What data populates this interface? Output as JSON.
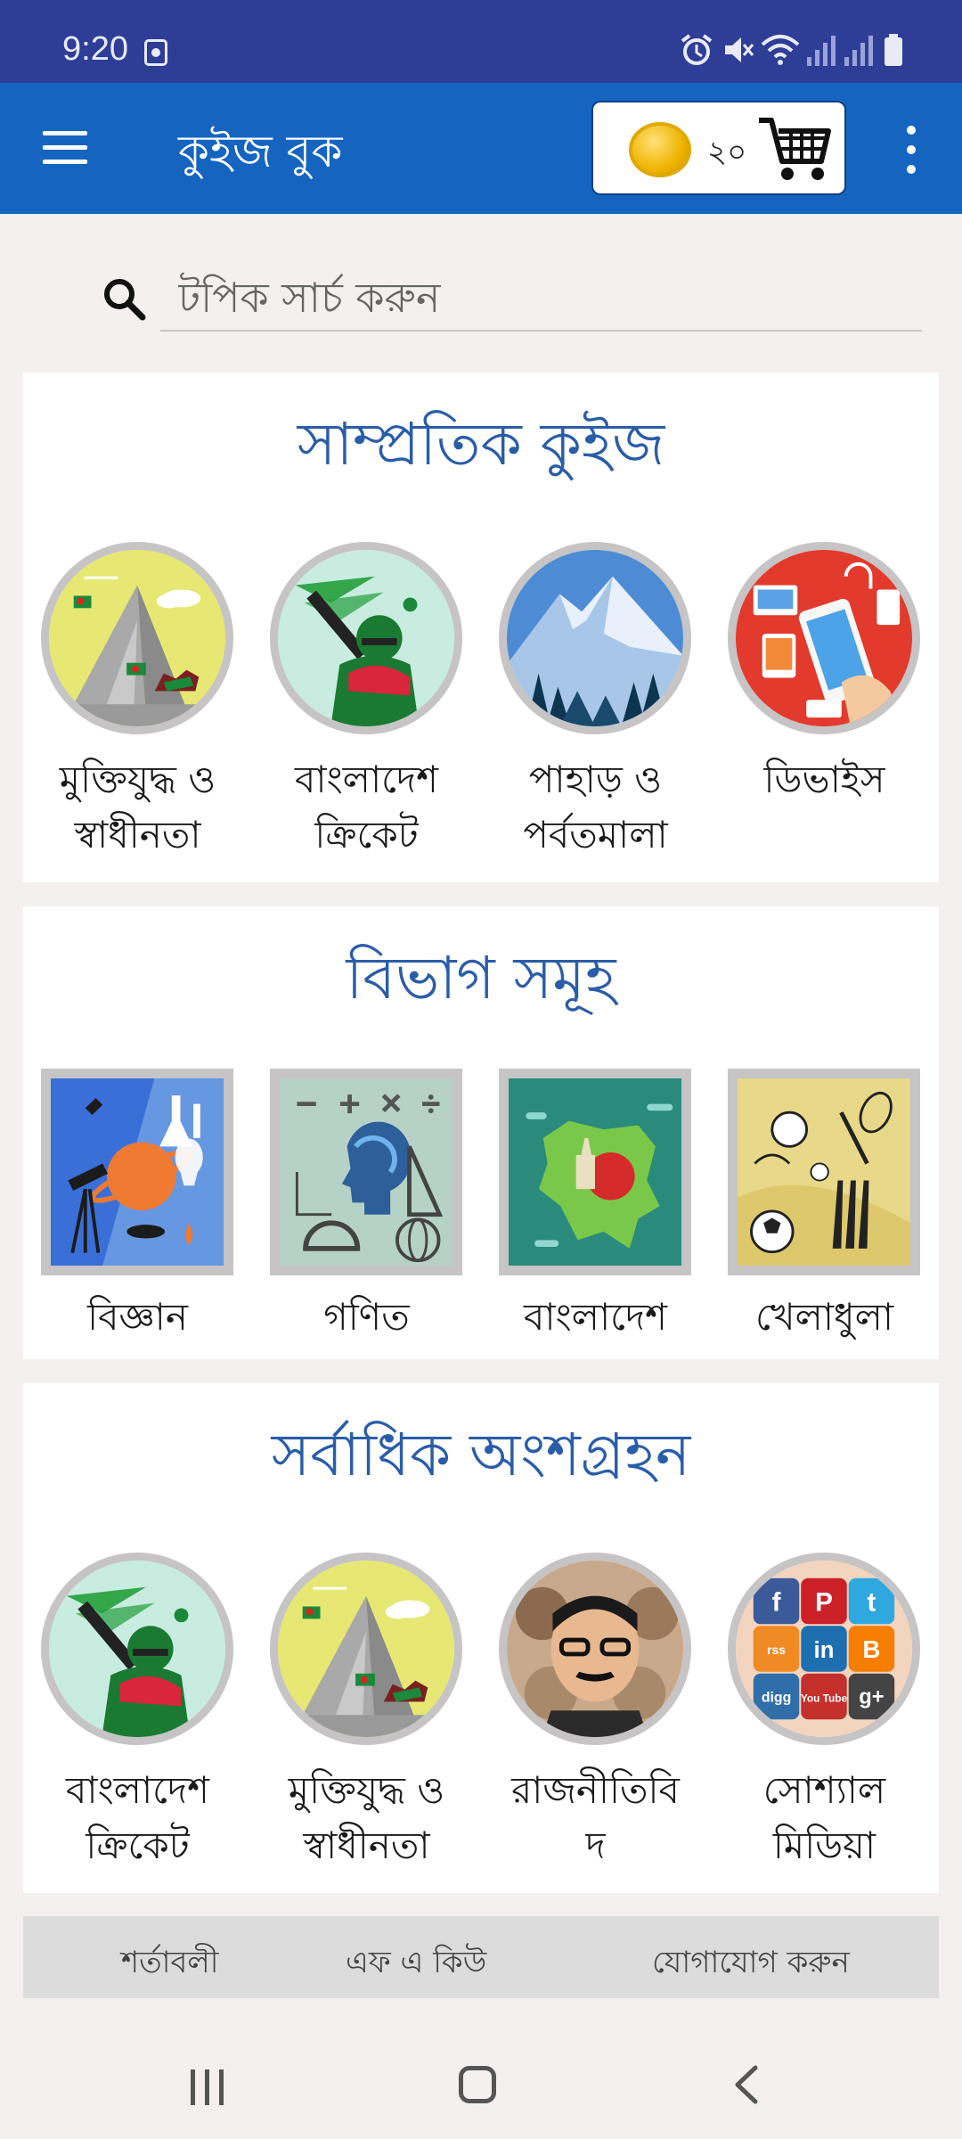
{
  "status_bar": {
    "time": "9:20",
    "icons": [
      "app-notification-icon",
      "alarm-icon",
      "mute-icon",
      "wifi-icon",
      "signal-icon",
      "signal-icon",
      "battery-icon"
    ]
  },
  "app_bar": {
    "title": "কুইজ বুক",
    "coin_count": "২০",
    "icons": [
      "menu-icon",
      "coin-icon",
      "cart-icon",
      "overflow-menu-icon"
    ]
  },
  "search": {
    "placeholder": "টপিক সার্চ করুন"
  },
  "sections": {
    "recent": {
      "title": "সাম্প্রতিক কুইজ",
      "items": [
        {
          "label": "মুক্তিযুদ্ধ ও\nস্বাধীনতা",
          "image": "martyrs-monument-icon"
        },
        {
          "label": "বাংলাদেশ\nক্রিকেট",
          "image": "cricket-batsman-icon"
        },
        {
          "label": "পাহাড় ও\nপর্বতমালা",
          "image": "mountain-icon"
        },
        {
          "label": "ডিভাইস",
          "image": "devices-icon"
        }
      ]
    },
    "categories": {
      "title": "বিভাগ সমূহ",
      "items": [
        {
          "label": "বিজ্ঞান",
          "image": "science-icon"
        },
        {
          "label": "গণিত",
          "image": "math-icon"
        },
        {
          "label": "বাংলাদেশ",
          "image": "bangladesh-map-icon"
        },
        {
          "label": "খেলাধুলা",
          "image": "sports-icon"
        }
      ]
    },
    "popular": {
      "title": "সর্বাধিক অংশগ্রহন",
      "items": [
        {
          "label": "বাংলাদেশ\nক্রিকেট",
          "image": "cricket-batsman-icon"
        },
        {
          "label": "মুক্তিযুদ্ধ ও\nস্বাধীনতা",
          "image": "martyrs-monument-icon"
        },
        {
          "label": "রাজনীতিবি\nদ",
          "image": "politicians-portrait-icon"
        },
        {
          "label": "সোশ্যাল\nমিডিয়া",
          "image": "social-media-icon"
        }
      ]
    }
  },
  "social_tiles": [
    "f",
    "P",
    "t",
    "rss",
    "in",
    "B",
    "digg",
    "You Tube",
    "g+"
  ],
  "footer": {
    "terms": "শর্তাবলী",
    "faq": "এফ এ কিউ",
    "contact": "যোগাযোগ করুন"
  },
  "nav_bar": {
    "icons": [
      "recent-apps-icon",
      "home-icon",
      "back-icon"
    ]
  },
  "colors": {
    "status_bar": "#2e3d96",
    "app_bar": "#1565c0",
    "section_title": "#2a5da8",
    "page_bg": "#f3f0ef",
    "footer_bg": "#dddcdc"
  }
}
